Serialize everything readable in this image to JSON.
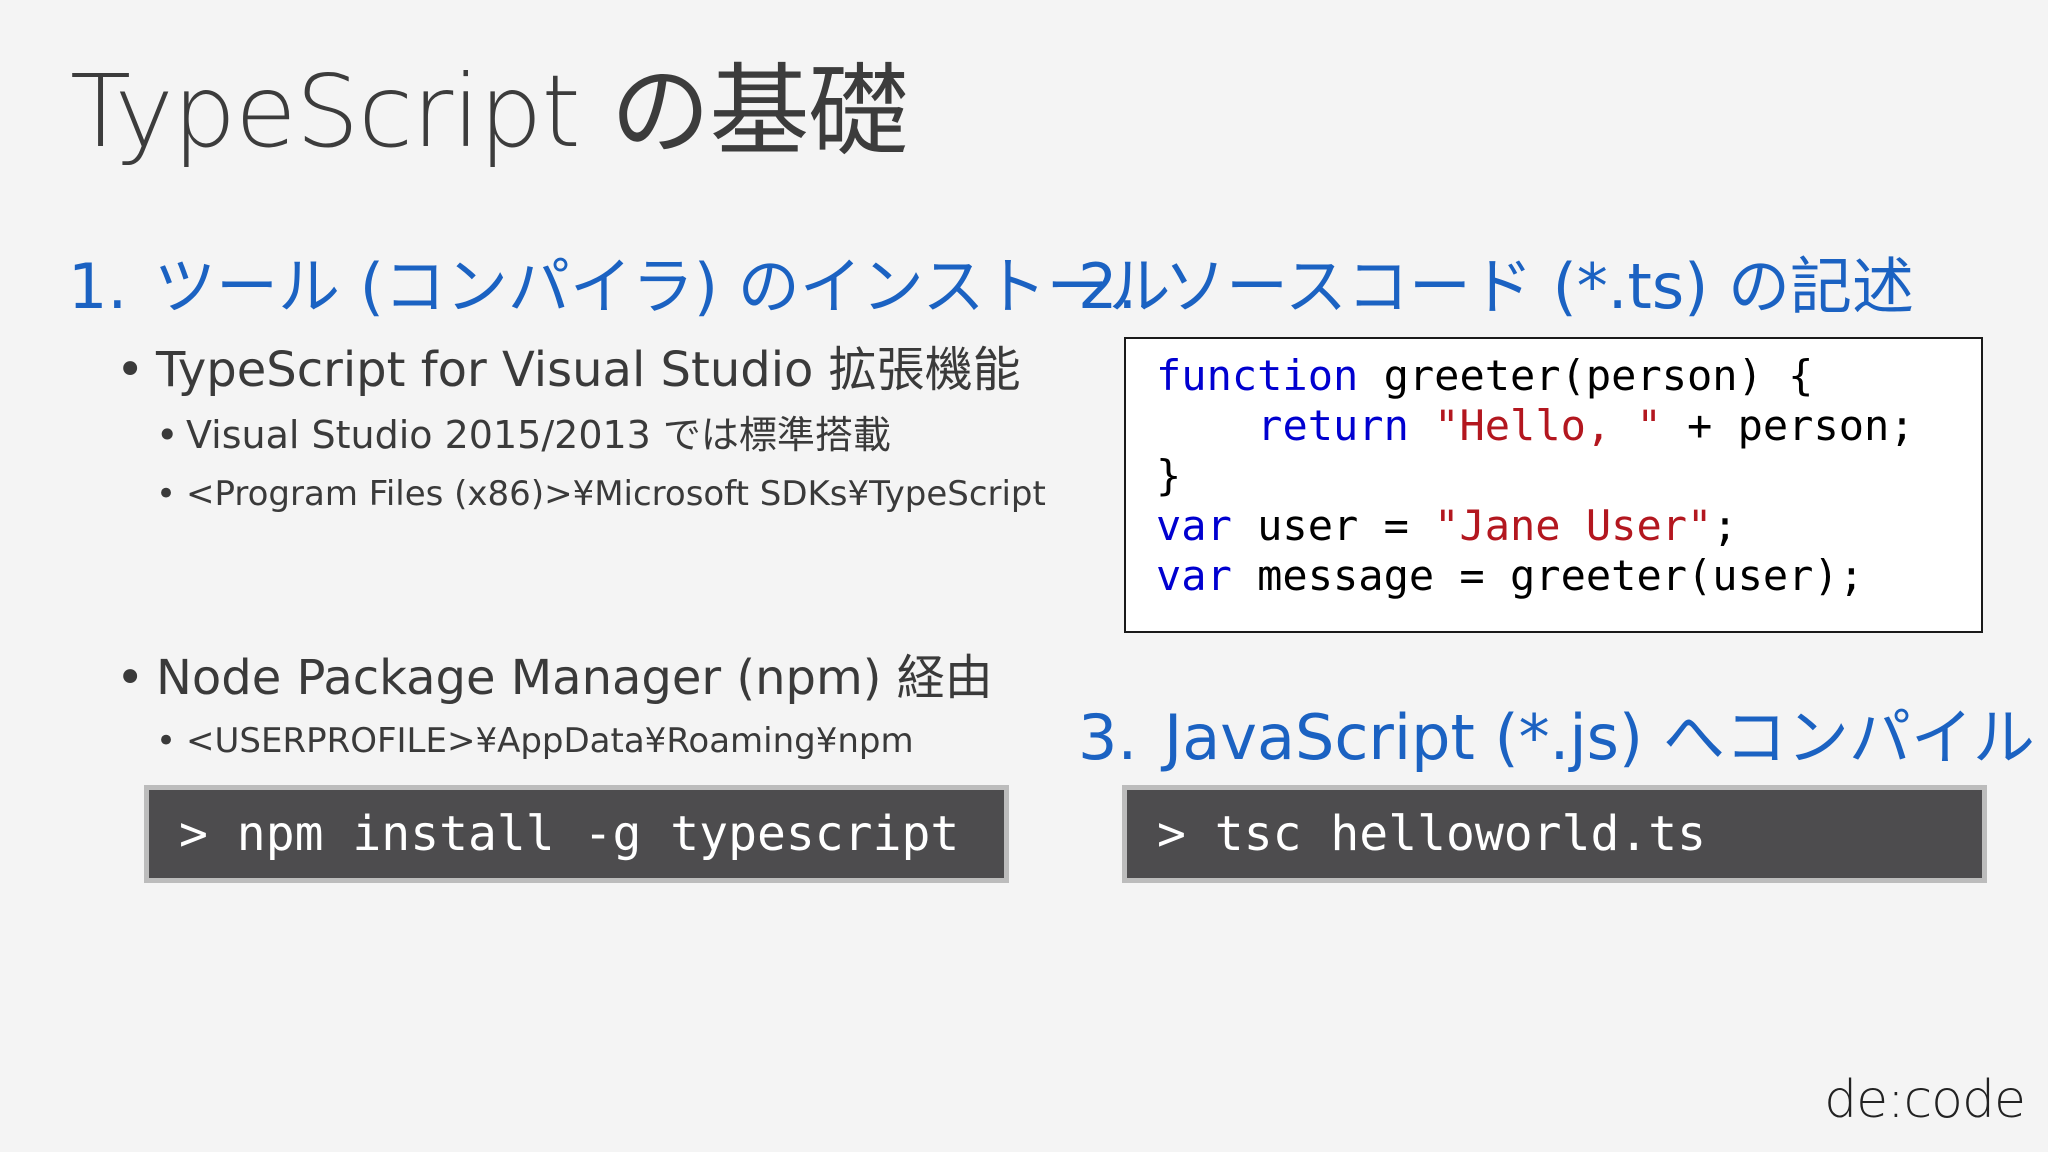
{
  "slide": {
    "title": "TypeScript の基礎",
    "logo": "de:code"
  },
  "step1": {
    "number": "1.",
    "heading": "ツール (コンパイラ) のインストール",
    "bullet_a": {
      "text": "TypeScript for Visual Studio 拡張機能",
      "sub1": "Visual Studio 2015/2013 では標準搭載",
      "sub2": "<Program Files (x86)>¥Microsoft SDKs¥TypeScript"
    },
    "bullet_b": {
      "text": "Node Package Manager (npm) 経由",
      "sub1": "<USERPROFILE>¥AppData¥Roaming¥npm"
    },
    "command": "> npm install -g typescript"
  },
  "step2": {
    "number": "2.",
    "heading": "ソースコード (*.ts) の記述",
    "code": {
      "l1_kw": "function",
      "l1_rest": " greeter(person) {",
      "l2_indent": "    ",
      "l2_kw": "return",
      "l2_sp": " ",
      "l2_str": "\"Hello, \"",
      "l2_rest": " + person;",
      "l3": "}",
      "l4_kw": "var",
      "l4_mid": " user = ",
      "l4_str": "\"Jane User\"",
      "l4_end": ";",
      "l5_kw": "var",
      "l5_rest": " message = greeter(user);"
    }
  },
  "step3": {
    "number": "3.",
    "heading": "JavaScript (*.js) へコンパイル",
    "command": "> tsc helloworld.ts"
  },
  "colors": {
    "background": "#f4f4f4",
    "heading_blue": "#1b62c2",
    "keyword_blue": "#0000d0",
    "string_red": "#b3171f",
    "command_bg": "#4d4c4e"
  }
}
